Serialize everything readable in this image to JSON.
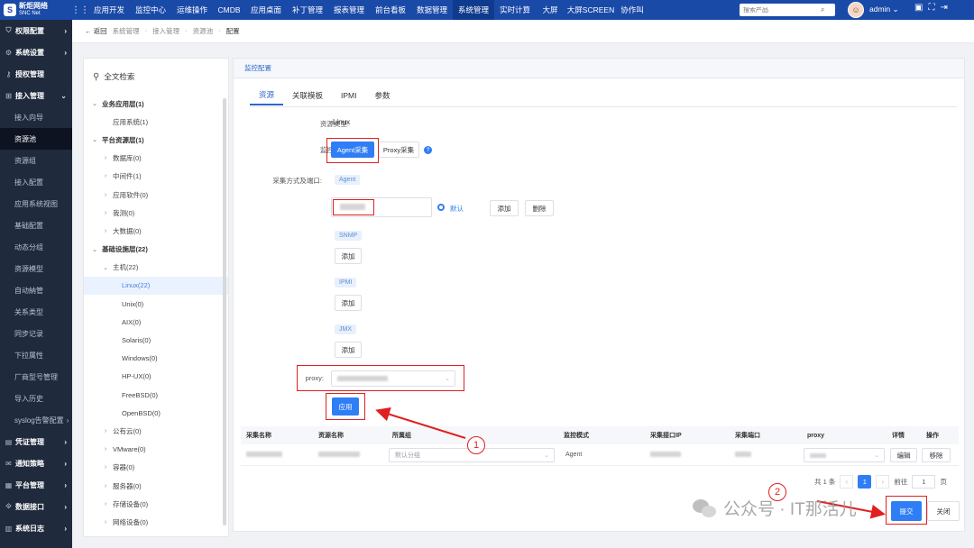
{
  "app": {
    "logo_line1": "新炬网络",
    "logo_line2": "SNC Net",
    "nav": [
      "应用开发",
      "监控中心",
      "运维操作",
      "CMDB",
      "应用桌面",
      "补丁管理",
      "报表管理",
      "前台看板",
      "数据管理",
      "系统管理",
      "实时计算",
      "大屏",
      "大屏SCREEN",
      "协作叫"
    ],
    "active_nav": "系统管理",
    "search_placeholder": "搜索产品",
    "user": "admin"
  },
  "sidebar": {
    "items": [
      {
        "label": "权限配置",
        "icon": "shield-icon",
        "arrow": "›",
        "type": "group"
      },
      {
        "label": "系统设置",
        "icon": "gear-icon",
        "arrow": "›",
        "type": "group"
      },
      {
        "label": "授权管理",
        "icon": "key-icon",
        "arrow": "",
        "type": "group"
      },
      {
        "label": "接入管理",
        "icon": "plug-icon",
        "arrow": "⌄",
        "type": "group"
      },
      {
        "label": "接入向导",
        "type": "sub"
      },
      {
        "label": "资源池",
        "type": "sub",
        "active": true
      },
      {
        "label": "资源组",
        "type": "sub"
      },
      {
        "label": "接入配置",
        "type": "sub"
      },
      {
        "label": "应用系统视图",
        "type": "sub"
      },
      {
        "label": "基础配置",
        "type": "sub"
      },
      {
        "label": "动态分组",
        "type": "sub"
      },
      {
        "label": "资源模型",
        "type": "sub"
      },
      {
        "label": "自动納管",
        "type": "sub"
      },
      {
        "label": "关系类型",
        "type": "sub"
      },
      {
        "label": "同步记录",
        "type": "sub"
      },
      {
        "label": "下拉属性",
        "type": "sub"
      },
      {
        "label": "厂商型号管理",
        "type": "sub"
      },
      {
        "label": "导入历史",
        "type": "sub"
      },
      {
        "label": "syslog告警配置",
        "type": "sub",
        "arrow": "›"
      },
      {
        "label": "凭证管理",
        "icon": "credential-icon",
        "arrow": "›",
        "type": "group"
      },
      {
        "label": "通知策略",
        "icon": "bell-icon",
        "arrow": "›",
        "type": "group"
      },
      {
        "label": "平台管理",
        "icon": "platform-icon",
        "arrow": "›",
        "type": "group"
      },
      {
        "label": "数据接口",
        "icon": "api-icon",
        "arrow": "›",
        "type": "group"
      },
      {
        "label": "系统日志",
        "icon": "log-icon",
        "arrow": "›",
        "type": "group"
      }
    ]
  },
  "breadcrumb": {
    "back": "← 返回",
    "items": [
      "系统管理",
      "接入管理",
      "资源池",
      "配置"
    ],
    "sep": "›"
  },
  "tree": {
    "title": "全文检索",
    "nodes": [
      {
        "label": "业务应用层(1)",
        "level": 0,
        "caret": "⌄",
        "bold": true
      },
      {
        "label": "应用系统(1)",
        "level": 1,
        "caret": ""
      },
      {
        "label": "平台资源层(1)",
        "level": 0,
        "caret": "⌄",
        "bold": true
      },
      {
        "label": "数据库(0)",
        "level": 1,
        "caret": "›"
      },
      {
        "label": "中间件(1)",
        "level": 1,
        "caret": "›"
      },
      {
        "label": "应用软件(0)",
        "level": 1,
        "caret": "›"
      },
      {
        "label": "我测(0)",
        "level": 1,
        "caret": "›"
      },
      {
        "label": "大数据(0)",
        "level": 1,
        "caret": "›"
      },
      {
        "label": "基础设施层(22)",
        "level": 0,
        "caret": "⌄",
        "bold": true
      },
      {
        "label": "主机(22)",
        "level": 1,
        "caret": "⌄"
      },
      {
        "label": "Linux(22)",
        "level": 2,
        "caret": "",
        "selected": true
      },
      {
        "label": "Unix(0)",
        "level": 2,
        "caret": ""
      },
      {
        "label": "AIX(0)",
        "level": 2,
        "caret": ""
      },
      {
        "label": "Solaris(0)",
        "level": 2,
        "caret": ""
      },
      {
        "label": "Windows(0)",
        "level": 2,
        "caret": ""
      },
      {
        "label": "HP-UX(0)",
        "level": 2,
        "caret": ""
      },
      {
        "label": "FreeBSD(0)",
        "level": 2,
        "caret": ""
      },
      {
        "label": "OpenBSD(0)",
        "level": 2,
        "caret": ""
      },
      {
        "label": "公有云(0)",
        "level": 1,
        "caret": "›"
      },
      {
        "label": "VMware(0)",
        "level": 1,
        "caret": "›"
      },
      {
        "label": "容器(0)",
        "level": 1,
        "caret": "›"
      },
      {
        "label": "服务器(0)",
        "level": 1,
        "caret": "›"
      },
      {
        "label": "存储设备(0)",
        "level": 1,
        "caret": "›"
      },
      {
        "label": "网络设备(0)",
        "level": 1,
        "caret": "›"
      }
    ]
  },
  "config": {
    "card_title": "监控配置",
    "tabs": [
      "资源",
      "关联模板",
      "IPMI",
      "参数"
    ],
    "active_tab": "资源",
    "resource_type_label": "资源类型:",
    "resource_type_value": "Linux",
    "monitor_mode_label": "监控模式:",
    "mode_agent": "Agent采集",
    "mode_proxy": "Proxy采集",
    "info_mark": "?",
    "collect_label": "采集方式及端口:",
    "chip_agent": "Agent",
    "default_label": "默认",
    "add": "添加",
    "delete": "删除",
    "chip_snmp": "SNMP",
    "chip_ipmi": "IPMI",
    "chip_jmx": "JMX",
    "proxy_label": "proxy:",
    "apply": "应用"
  },
  "table": {
    "headers": [
      "采集名称",
      "资源名称",
      "所属组",
      "监控模式",
      "采集接口IP",
      "采集端口",
      "proxy",
      "详情",
      "操作"
    ],
    "row": {
      "group_placeholder": "默认分组",
      "mode": "Agent",
      "detail_btn": "编辑",
      "remove_btn": "移除"
    }
  },
  "pager": {
    "total": "共 1 条",
    "prev": "‹",
    "page": "1",
    "next": "›",
    "goto": "前往",
    "goto_value": "1",
    "unit": "页"
  },
  "footer": {
    "confirm": "提交",
    "close": "关闭"
  },
  "annotations": {
    "step1": "1",
    "step2": "2",
    "watermark": "公众号 · IT那活儿"
  },
  "colors": {
    "topbar": "#1a4aa8",
    "sidebar": "#1f2a3d",
    "primary": "#2f7ef5",
    "annotation": "#e02020"
  }
}
